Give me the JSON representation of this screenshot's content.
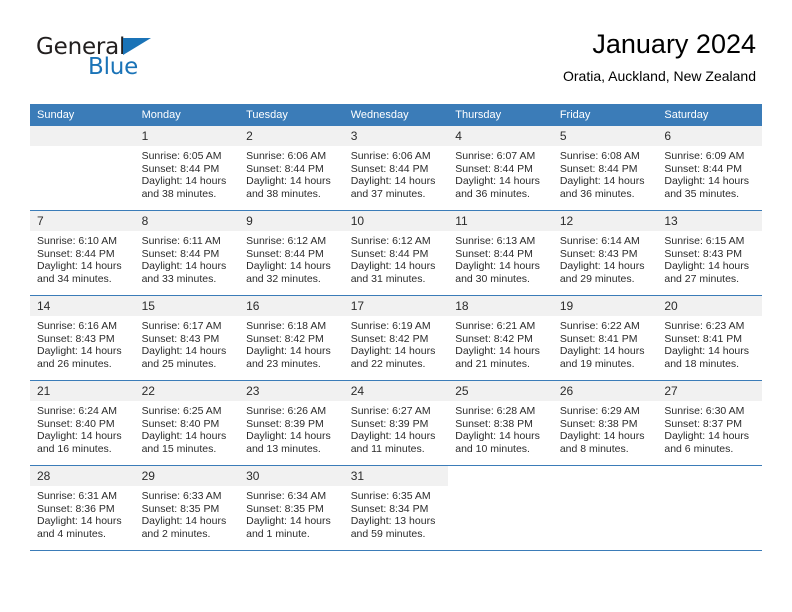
{
  "brand": {
    "name_part1": "General",
    "name_part2": "Blue",
    "triangle_icon": "triangle-icon",
    "colors": {
      "dark": "#221f1f",
      "blue": "#1a73b7"
    }
  },
  "header": {
    "title": "January 2024",
    "subtitle": "Oratia, Auckland, New Zealand"
  },
  "theme": {
    "header_blue": "#3b7cb8",
    "daynum_band": "#f1f1f1",
    "text": "#2b2b2b"
  },
  "weekdays": [
    "Sunday",
    "Monday",
    "Tuesday",
    "Wednesday",
    "Thursday",
    "Friday",
    "Saturday"
  ],
  "weeks": [
    [
      {
        "day": "",
        "sunrise": "",
        "sunset": "",
        "daylight": "",
        "empty": true
      },
      {
        "day": "1",
        "sunrise": "Sunrise: 6:05 AM",
        "sunset": "Sunset: 8:44 PM",
        "daylight": "Daylight: 14 hours and 38 minutes."
      },
      {
        "day": "2",
        "sunrise": "Sunrise: 6:06 AM",
        "sunset": "Sunset: 8:44 PM",
        "daylight": "Daylight: 14 hours and 38 minutes."
      },
      {
        "day": "3",
        "sunrise": "Sunrise: 6:06 AM",
        "sunset": "Sunset: 8:44 PM",
        "daylight": "Daylight: 14 hours and 37 minutes."
      },
      {
        "day": "4",
        "sunrise": "Sunrise: 6:07 AM",
        "sunset": "Sunset: 8:44 PM",
        "daylight": "Daylight: 14 hours and 36 minutes."
      },
      {
        "day": "5",
        "sunrise": "Sunrise: 6:08 AM",
        "sunset": "Sunset: 8:44 PM",
        "daylight": "Daylight: 14 hours and 36 minutes."
      },
      {
        "day": "6",
        "sunrise": "Sunrise: 6:09 AM",
        "sunset": "Sunset: 8:44 PM",
        "daylight": "Daylight: 14 hours and 35 minutes."
      }
    ],
    [
      {
        "day": "7",
        "sunrise": "Sunrise: 6:10 AM",
        "sunset": "Sunset: 8:44 PM",
        "daylight": "Daylight: 14 hours and 34 minutes."
      },
      {
        "day": "8",
        "sunrise": "Sunrise: 6:11 AM",
        "sunset": "Sunset: 8:44 PM",
        "daylight": "Daylight: 14 hours and 33 minutes."
      },
      {
        "day": "9",
        "sunrise": "Sunrise: 6:12 AM",
        "sunset": "Sunset: 8:44 PM",
        "daylight": "Daylight: 14 hours and 32 minutes."
      },
      {
        "day": "10",
        "sunrise": "Sunrise: 6:12 AM",
        "sunset": "Sunset: 8:44 PM",
        "daylight": "Daylight: 14 hours and 31 minutes."
      },
      {
        "day": "11",
        "sunrise": "Sunrise: 6:13 AM",
        "sunset": "Sunset: 8:44 PM",
        "daylight": "Daylight: 14 hours and 30 minutes."
      },
      {
        "day": "12",
        "sunrise": "Sunrise: 6:14 AM",
        "sunset": "Sunset: 8:43 PM",
        "daylight": "Daylight: 14 hours and 29 minutes."
      },
      {
        "day": "13",
        "sunrise": "Sunrise: 6:15 AM",
        "sunset": "Sunset: 8:43 PM",
        "daylight": "Daylight: 14 hours and 27 minutes."
      }
    ],
    [
      {
        "day": "14",
        "sunrise": "Sunrise: 6:16 AM",
        "sunset": "Sunset: 8:43 PM",
        "daylight": "Daylight: 14 hours and 26 minutes."
      },
      {
        "day": "15",
        "sunrise": "Sunrise: 6:17 AM",
        "sunset": "Sunset: 8:43 PM",
        "daylight": "Daylight: 14 hours and 25 minutes."
      },
      {
        "day": "16",
        "sunrise": "Sunrise: 6:18 AM",
        "sunset": "Sunset: 8:42 PM",
        "daylight": "Daylight: 14 hours and 23 minutes."
      },
      {
        "day": "17",
        "sunrise": "Sunrise: 6:19 AM",
        "sunset": "Sunset: 8:42 PM",
        "daylight": "Daylight: 14 hours and 22 minutes."
      },
      {
        "day": "18",
        "sunrise": "Sunrise: 6:21 AM",
        "sunset": "Sunset: 8:42 PM",
        "daylight": "Daylight: 14 hours and 21 minutes."
      },
      {
        "day": "19",
        "sunrise": "Sunrise: 6:22 AM",
        "sunset": "Sunset: 8:41 PM",
        "daylight": "Daylight: 14 hours and 19 minutes."
      },
      {
        "day": "20",
        "sunrise": "Sunrise: 6:23 AM",
        "sunset": "Sunset: 8:41 PM",
        "daylight": "Daylight: 14 hours and 18 minutes."
      }
    ],
    [
      {
        "day": "21",
        "sunrise": "Sunrise: 6:24 AM",
        "sunset": "Sunset: 8:40 PM",
        "daylight": "Daylight: 14 hours and 16 minutes."
      },
      {
        "day": "22",
        "sunrise": "Sunrise: 6:25 AM",
        "sunset": "Sunset: 8:40 PM",
        "daylight": "Daylight: 14 hours and 15 minutes."
      },
      {
        "day": "23",
        "sunrise": "Sunrise: 6:26 AM",
        "sunset": "Sunset: 8:39 PM",
        "daylight": "Daylight: 14 hours and 13 minutes."
      },
      {
        "day": "24",
        "sunrise": "Sunrise: 6:27 AM",
        "sunset": "Sunset: 8:39 PM",
        "daylight": "Daylight: 14 hours and 11 minutes."
      },
      {
        "day": "25",
        "sunrise": "Sunrise: 6:28 AM",
        "sunset": "Sunset: 8:38 PM",
        "daylight": "Daylight: 14 hours and 10 minutes."
      },
      {
        "day": "26",
        "sunrise": "Sunrise: 6:29 AM",
        "sunset": "Sunset: 8:38 PM",
        "daylight": "Daylight: 14 hours and 8 minutes."
      },
      {
        "day": "27",
        "sunrise": "Sunrise: 6:30 AM",
        "sunset": "Sunset: 8:37 PM",
        "daylight": "Daylight: 14 hours and 6 minutes."
      }
    ],
    [
      {
        "day": "28",
        "sunrise": "Sunrise: 6:31 AM",
        "sunset": "Sunset: 8:36 PM",
        "daylight": "Daylight: 14 hours and 4 minutes."
      },
      {
        "day": "29",
        "sunrise": "Sunrise: 6:33 AM",
        "sunset": "Sunset: 8:35 PM",
        "daylight": "Daylight: 14 hours and 2 minutes."
      },
      {
        "day": "30",
        "sunrise": "Sunrise: 6:34 AM",
        "sunset": "Sunset: 8:35 PM",
        "daylight": "Daylight: 14 hours and 1 minute."
      },
      {
        "day": "31",
        "sunrise": "Sunrise: 6:35 AM",
        "sunset": "Sunset: 8:34 PM",
        "daylight": "Daylight: 13 hours and 59 minutes."
      },
      {
        "day": "",
        "sunrise": "",
        "sunset": "",
        "daylight": "",
        "void": true
      },
      {
        "day": "",
        "sunrise": "",
        "sunset": "",
        "daylight": "",
        "void": true
      },
      {
        "day": "",
        "sunrise": "",
        "sunset": "",
        "daylight": "",
        "void": true
      }
    ]
  ]
}
